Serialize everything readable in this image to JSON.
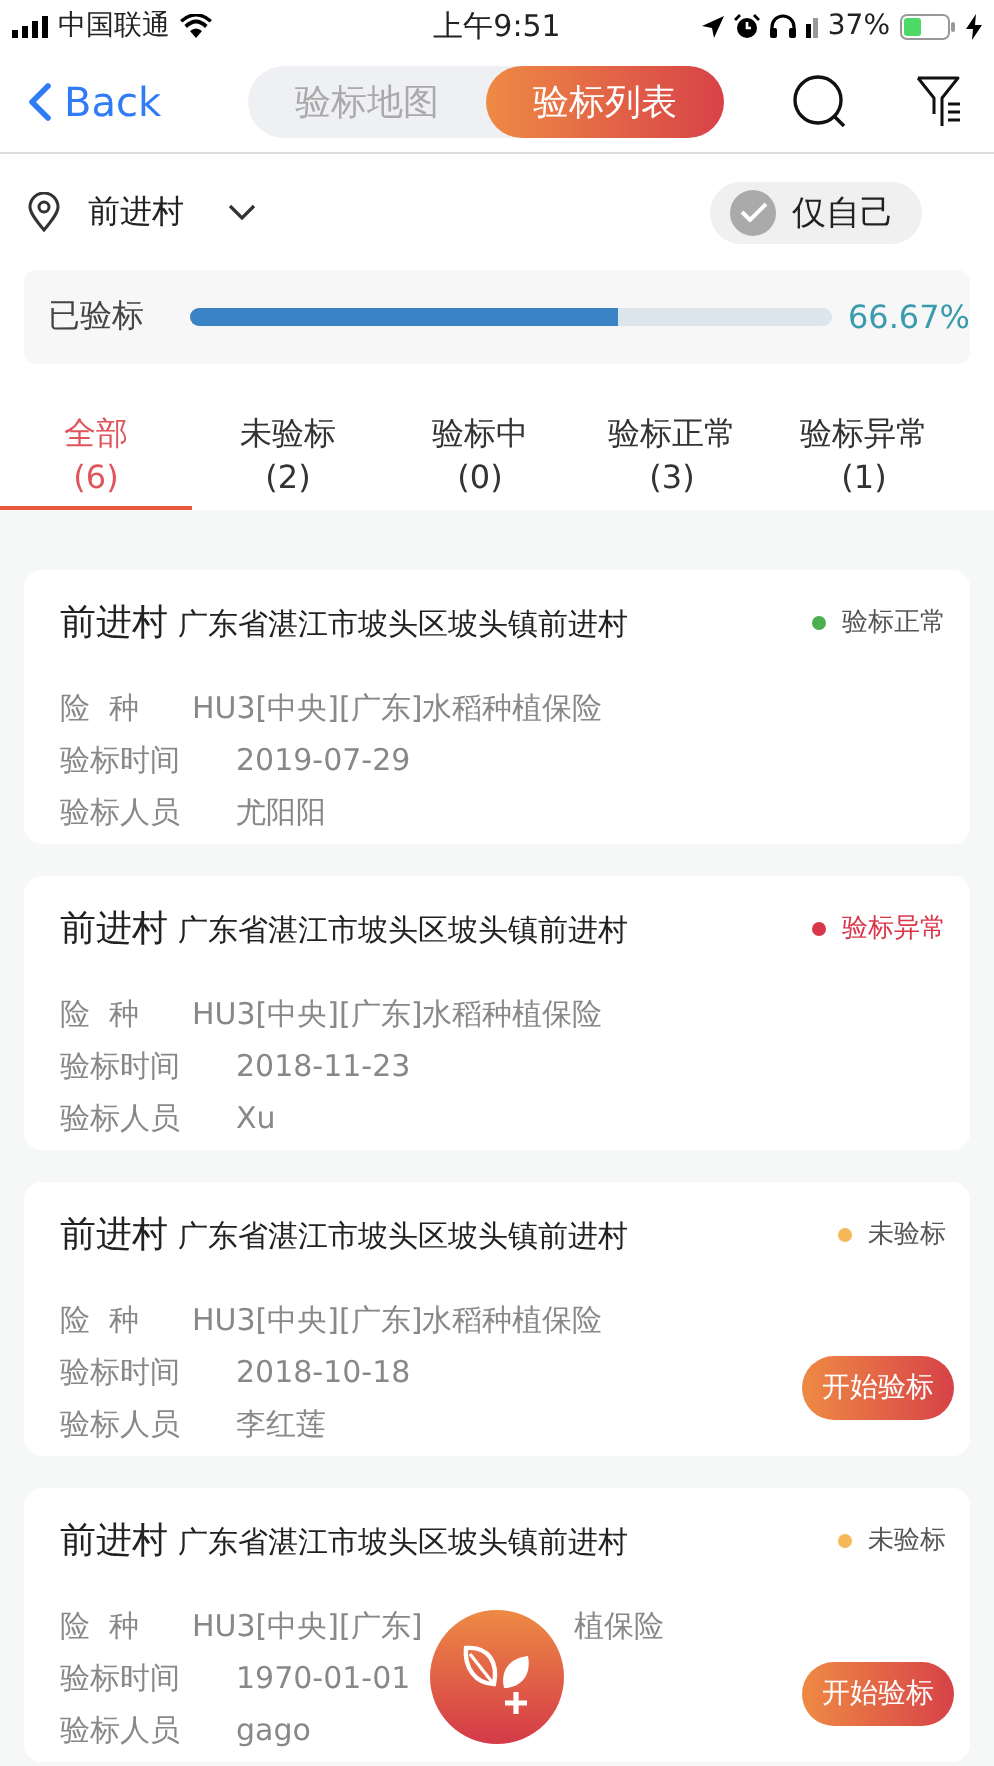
{
  "status_bar": {
    "carrier": "中国联通",
    "time": "上午9:51",
    "battery": "37%"
  },
  "nav": {
    "back": "Back",
    "segments": [
      {
        "label": "验标地图",
        "selected": false
      },
      {
        "label": "验标列表",
        "selected": true
      }
    ]
  },
  "location": {
    "name": "前进村"
  },
  "only_mine": {
    "label": "仅自己",
    "checked": true
  },
  "progress": {
    "label": "已验标",
    "level": 0.6667,
    "reading": "66.67%"
  },
  "tabs": [
    {
      "label": "全部",
      "count": "(6)",
      "selected": true
    },
    {
      "label": "未验标",
      "count": "(2)",
      "selected": false
    },
    {
      "label": "验标中",
      "count": "(0)",
      "selected": false
    },
    {
      "label": "验标正常",
      "count": "(3)",
      "selected": false
    },
    {
      "label": "验标异常",
      "count": "(1)",
      "selected": false
    }
  ],
  "records": [
    {
      "village": "前进村",
      "address": "广东省湛江市坡头区坡头镇前进村",
      "status": "验标正常",
      "color": "#4caf50",
      "insurance_label": "险  种",
      "insurance": "HU3[中央][广东]水稻种植保险",
      "date_label": "验标时间",
      "date": "2019-07-29",
      "inspector_label": "验标人员",
      "inspector": "尤阳阳"
    },
    {
      "village": "前进村",
      "address": "广东省湛江市坡头区坡头镇前进村",
      "status": "验标异常",
      "color": "#d9364a",
      "insurance_label": "险  种",
      "insurance": "HU3[中央][广东]水稻种植保险",
      "date_label": "验标时间",
      "date": "2018-11-23",
      "inspector_label": "验标人员",
      "inspector": "Xu"
    },
    {
      "village": "前进村",
      "address": "广东省湛江市坡头区坡头镇前进村",
      "status": "未验标",
      "color": "#f5b95a",
      "insurance_label": "险  种",
      "insurance": "HU3[中央][广东]水稻种植保险",
      "date_label": "验标时间",
      "date": "2018-10-18",
      "inspector_label": "验标人员",
      "inspector": "李红莲",
      "action": "开始验标"
    },
    {
      "village": "前进村",
      "address": "广东省湛江市坡头区坡头镇前进村",
      "status": "未验标",
      "color": "#f5b95a",
      "insurance_label": "险  种",
      "insurance": "HU3[中央][广东]",
      "insurance_tail": "植保险",
      "date_label": "验标时间",
      "date": "1970-01-01",
      "inspector_label": "验标人员",
      "inspector": "gago",
      "action": "开始验标"
    }
  ]
}
